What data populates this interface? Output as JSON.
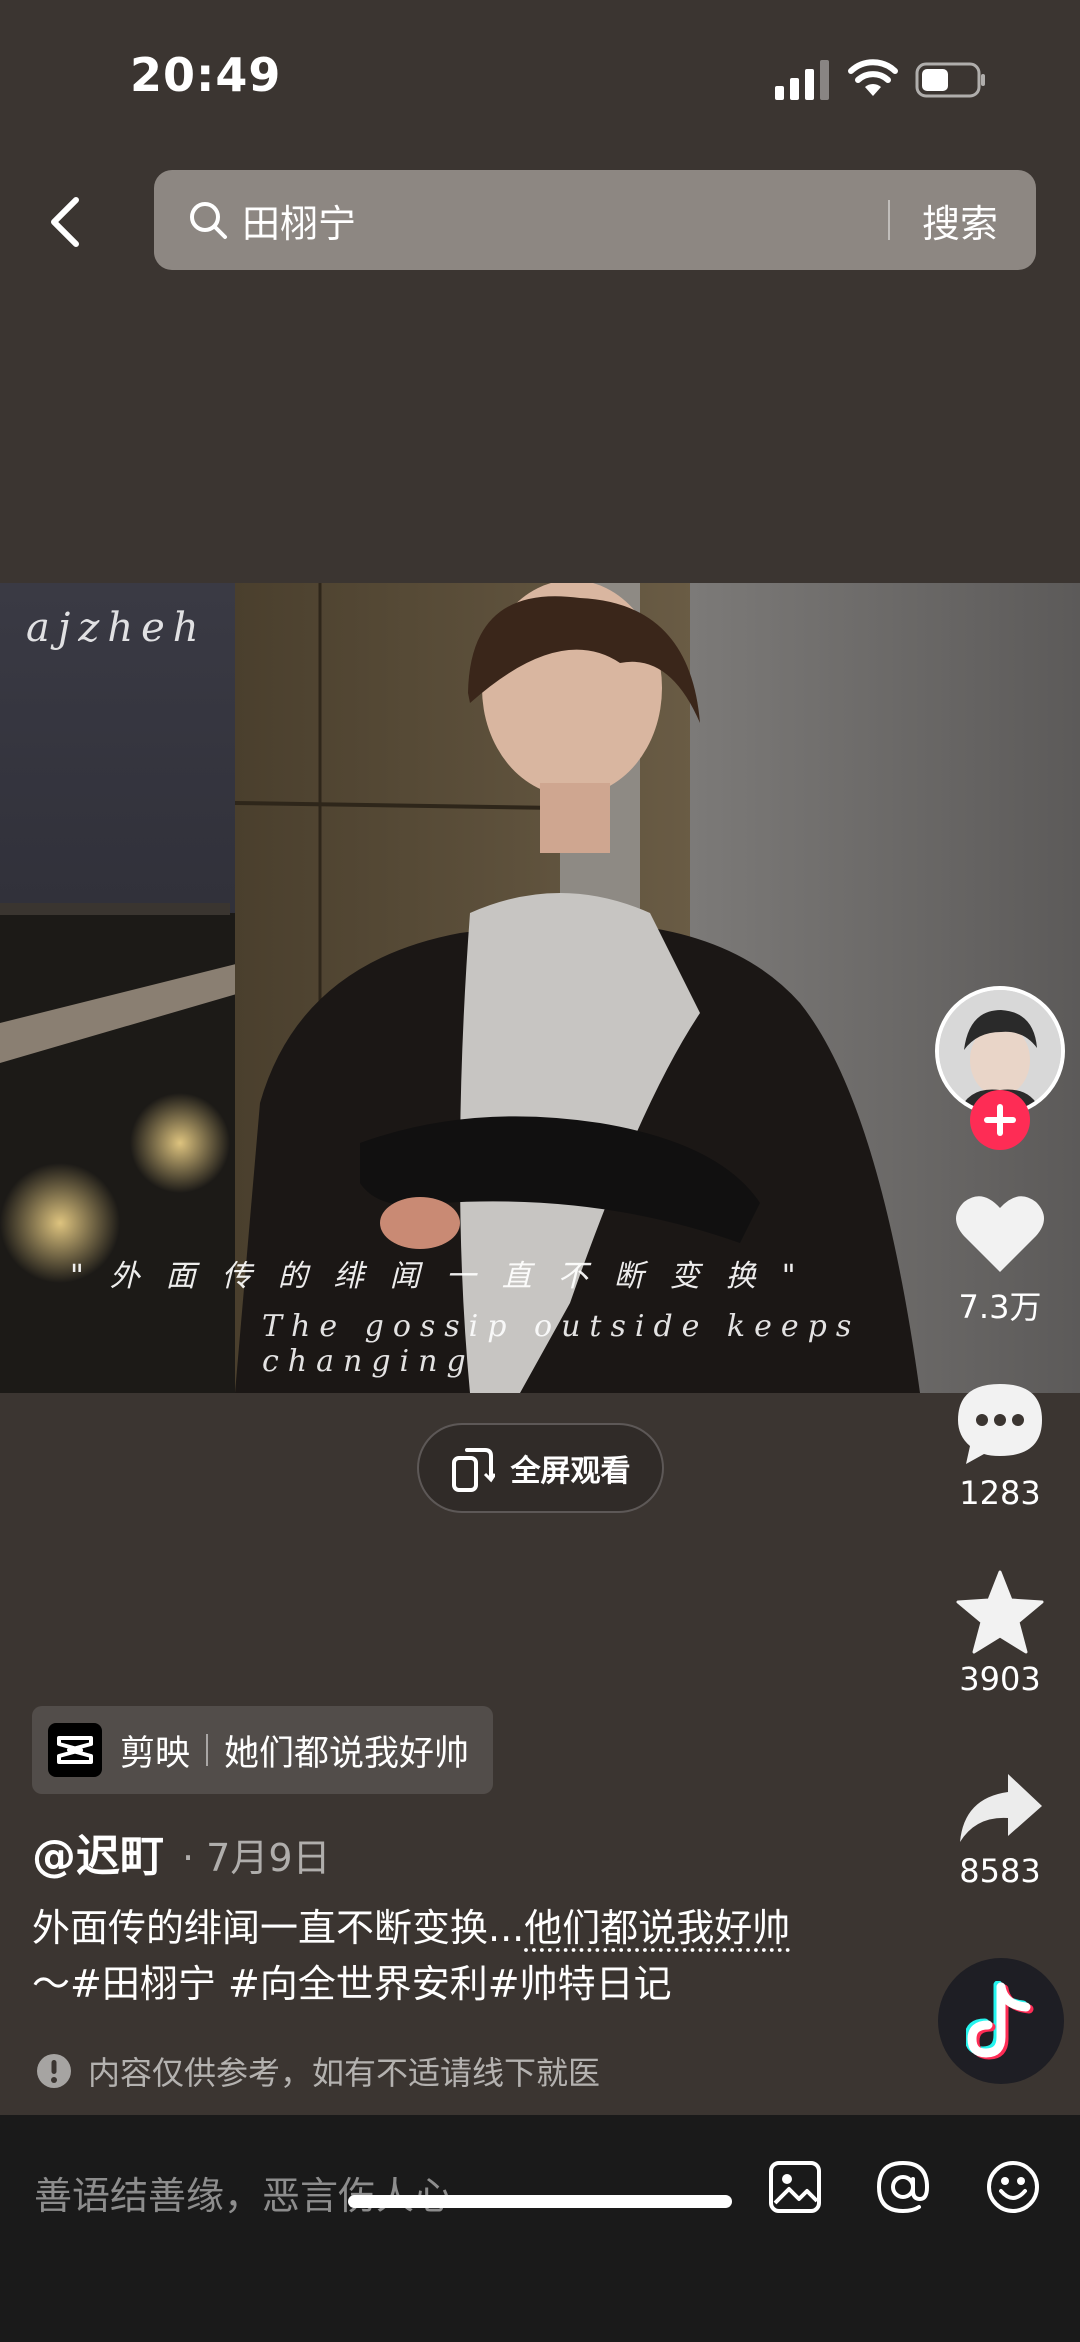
{
  "status_bar": {
    "time": "20:49"
  },
  "search": {
    "query": "田栩宁",
    "button_label": "搜索"
  },
  "video": {
    "watermark": "ajzheh",
    "caption_cn": "\"外面传的绯闻一直不断变换\"",
    "caption_en": "The gossip outside keeps changing",
    "fullscreen_label": "全屏观看"
  },
  "actions": {
    "likes": "7.3万",
    "comments": "1283",
    "favorites": "3903",
    "shares": "8583"
  },
  "capcut": {
    "app_name": "剪映",
    "template_name": "她们都说我好帅"
  },
  "post": {
    "author": "@迟町",
    "date": "· 7月9日",
    "desc_text": "外面传的绯闻一直不断变换...",
    "desc_link": "他们都说我好帅",
    "desc_suffix": "～",
    "hashtags": [
      "#田栩宁",
      " #向全世界安利",
      "#帅特日记"
    ]
  },
  "disclaimer": "内容仅供参考，如有不适请线下就医",
  "comment_bar": {
    "placeholder": "善语结善缘，恶言伤人心"
  },
  "colors": {
    "accent_red": "#fe2c55",
    "background": "#3b3531",
    "search_bg": "#8d8782"
  }
}
